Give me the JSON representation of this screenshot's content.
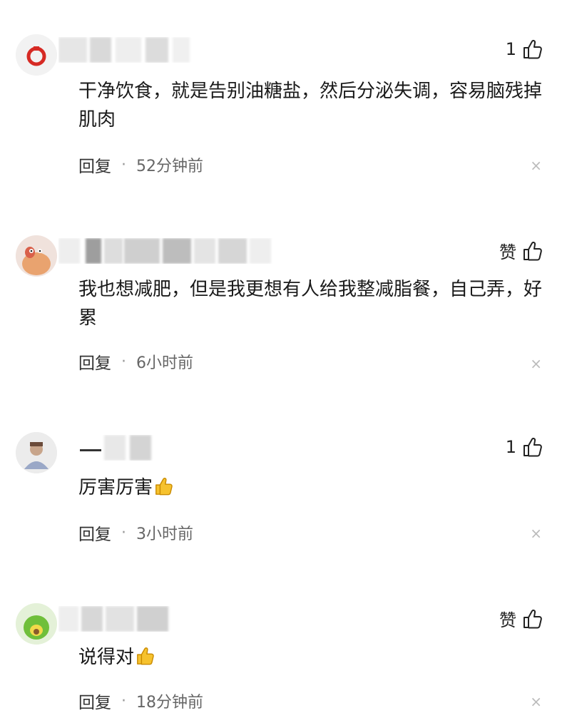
{
  "comments": [
    {
      "like": "1",
      "text": "干净饮食，就是告别油糖盐，然后分泌失调，容易脑残掉肌肉",
      "reply": "回复",
      "time": "52分钟前",
      "close": "×"
    },
    {
      "like": "赞",
      "text": "我也想减肥，但是我更想有人给我整减脂餐，自己弄，好累",
      "reply": "回复",
      "time": "6小时前",
      "close": "×"
    },
    {
      "like": "1",
      "text": "厉害厉害",
      "reply": "回复",
      "time": "3小时前",
      "close": "×"
    },
    {
      "like": "赞",
      "text": "说得对",
      "reply": "回复",
      "time": "18分钟前",
      "close": "×"
    }
  ],
  "separator": "·",
  "icons": {
    "like": "thumbs-up-icon",
    "emoji": "thumbs-up-emoji-icon",
    "close": "close-icon"
  }
}
